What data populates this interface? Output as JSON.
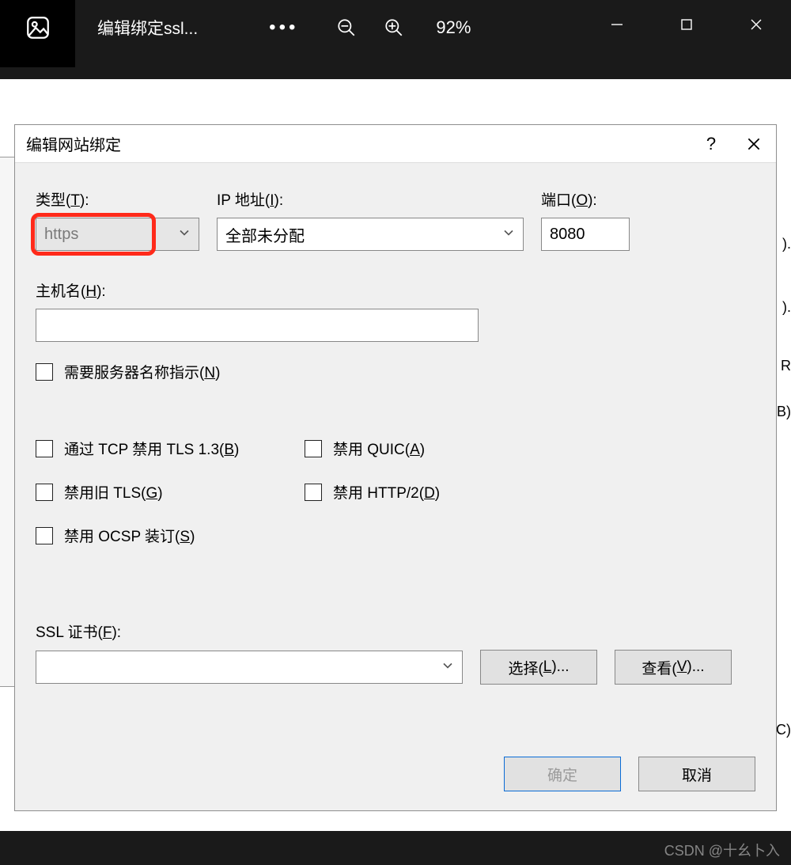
{
  "appbar": {
    "title": "编辑绑定ssl...",
    "zoom_pct": "92%"
  },
  "background_fragments": {
    "a_paren": ").",
    "dot_paren": ").",
    "r": "R",
    "b_paren": "B)",
    "c_paren": "C)"
  },
  "dialog": {
    "title": "编辑网站绑定",
    "help": "?",
    "labels": {
      "type_prefix": "类型(",
      "type_key": "T",
      "type_suffix": "):",
      "ip_prefix": "IP 地址(",
      "ip_key": "I",
      "ip_suffix": "):",
      "port_prefix": "端口(",
      "port_key": "O",
      "port_suffix": "):",
      "host_prefix": "主机名(",
      "host_key": "H",
      "host_suffix": "):",
      "ssl_prefix": "SSL 证书(",
      "ssl_key": "F",
      "ssl_suffix": "):"
    },
    "fields": {
      "type_value": "https",
      "ip_value": "全部未分配",
      "port_value": "8080",
      "host_value": "",
      "ssl_cert_value": ""
    },
    "checkboxes": {
      "sni": {
        "prefix": "需要服务器名称指示(",
        "key": "N",
        "suffix": ")"
      },
      "tls13": {
        "prefix": "通过 TCP 禁用 TLS 1.3(",
        "key": "B",
        "suffix": ")"
      },
      "quic": {
        "prefix": "禁用 QUIC(",
        "key": "A",
        "suffix": ")"
      },
      "oldtls": {
        "prefix": "禁用旧 TLS(",
        "key": "G",
        "suffix": ")"
      },
      "http2": {
        "prefix": "禁用 HTTP/2(",
        "key": "D",
        "suffix": ")"
      },
      "ocsp": {
        "prefix": "禁用 OCSP 装订(",
        "key": "S",
        "suffix": ")"
      }
    },
    "buttons": {
      "select_prefix": "选择(",
      "select_key": "L",
      "select_suffix": ")...",
      "view_prefix": "查看(",
      "view_key": "V",
      "view_suffix": ")...",
      "ok": "确定",
      "cancel": "取消"
    }
  },
  "watermark": "CSDN @十幺卜入"
}
